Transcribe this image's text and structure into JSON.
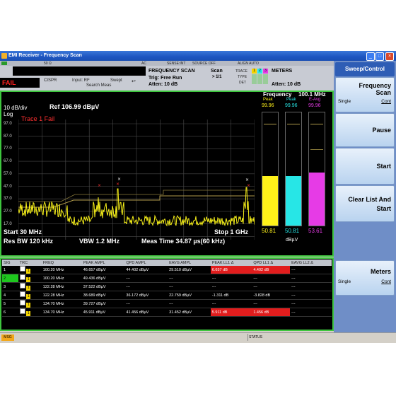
{
  "window": {
    "title": "EMI Receiver  - Frequency Scan",
    "controls": [
      "_",
      "□",
      "×"
    ]
  },
  "header": {
    "row1": {
      "impedance": "50 Ω",
      "coupling": "AC",
      "sense": "SENSE:INT",
      "source": "SOURCE OFF",
      "align": "ALIGN AUTO"
    },
    "cispr": "CISPR",
    "input": "Input: RF",
    "swept": "Swept",
    "search": "Search Meas",
    "scan_mode": "FREQUENCY SCAN",
    "trig": "Trig: Free Run",
    "atten_left": "Atten: 10 dB",
    "scan_label": "Scan",
    "scan_count": "> 1/1",
    "trace_label": "TRACE",
    "type_label": "TYPE",
    "det_label": "DET",
    "trace_nums": [
      "1",
      "2",
      "3"
    ],
    "meters_label": "METERS",
    "atten_right": "Atten: 10 dB",
    "fail": "FAIL"
  },
  "plot": {
    "scale": "10 dB/div",
    "log": "Log",
    "ref": "Ref 106.99 dBµV",
    "trace_fail": "Trace 1 Fail",
    "y_ticks": [
      "97.0",
      "87.0",
      "77.0",
      "67.0",
      "57.0",
      "47.0",
      "37.0",
      "27.0",
      "17.0"
    ],
    "start": "Start 30 MHz",
    "stop": "Stop 1 GHz",
    "res_bw": "Res BW 120 kHz",
    "vbw": "VBW 1.2 MHz",
    "meas_time": "Meas Time 34.87 µs(60 kHz)",
    "colors": {
      "trace": "#f5ee19",
      "limit": "#b09a4a",
      "grid": "#4b4b4b",
      "frame": "#3ec63e"
    }
  },
  "meters": {
    "title": "Frequency",
    "freq": "100.1 MHz",
    "headers": [
      "Peak",
      "Peak",
      "E-Avg"
    ],
    "values_top": [
      "99.96",
      "99.96",
      "99.96"
    ],
    "readings": [
      "50.81",
      "50.81",
      "53.61"
    ],
    "unit": "dBµV",
    "level_fraction": [
      0.44,
      0.44,
      0.47
    ],
    "colors": [
      "#fff21a",
      "#27e6e6",
      "#e63be6"
    ]
  },
  "table": {
    "headers": [
      "SIG",
      "TRC",
      "FREQ",
      "PEAK AMPL",
      "QPD AMPL",
      "EAVG AMPL",
      "PEAK LL1 Δ",
      "QPD LL1 Δ",
      "EAVG LL2 Δ"
    ],
    "rows": [
      {
        "sig": "1",
        "trc": "1",
        "freq": "100.20 MHz",
        "peak": "46.657 dBµV",
        "qpd": "44.402 dBµV",
        "eavg": "29.510 dBµV",
        "pk_d": "6.657 dB",
        "qpd_d": "4.402 dB",
        "eavg_d": "---"
      },
      {
        "sig": "2",
        "trc": "1",
        "freq": "100.20 MHz",
        "peak": "49.436 dBµV",
        "qpd": "---",
        "eavg": "---",
        "pk_d": "---",
        "qpd_d": "---",
        "eavg_d": "---"
      },
      {
        "sig": "3",
        "trc": "1",
        "freq": "122.28 MHz",
        "peak": "37.522 dBµV",
        "qpd": "---",
        "eavg": "---",
        "pk_d": "---",
        "qpd_d": "---",
        "eavg_d": "---"
      },
      {
        "sig": "4",
        "trc": "1",
        "freq": "122.28 MHz",
        "peak": "38.689 dBµV",
        "qpd": "36.172 dBµV",
        "eavg": "22.759 dBµV",
        "pk_d": "-1.311 dB",
        "qpd_d": "-3.828 dB",
        "eavg_d": "---"
      },
      {
        "sig": "5",
        "trc": "1",
        "freq": "134.70 MHz",
        "peak": "39.727 dBµV",
        "qpd": "---",
        "eavg": "---",
        "pk_d": "---",
        "qpd_d": "---",
        "eavg_d": "---"
      },
      {
        "sig": "6",
        "trc": "1",
        "freq": "134.70 MHz",
        "peak": "45.911 dBµV",
        "qpd": "41.456 dBµV",
        "eavg": "31.452 dBµV",
        "pk_d": "5.911 dB",
        "qpd_d": "1.456 dB",
        "eavg_d": "---"
      }
    ]
  },
  "softkeys": {
    "title": "Sweep/Control",
    "frequency_scan": {
      "label1": "Frequency",
      "label2": "Scan",
      "left": "Single",
      "right": "Cont"
    },
    "pause": "Pause",
    "start": "Start",
    "clear_list": {
      "label1": "Clear List And",
      "label2": "Start"
    },
    "meters": {
      "label": "Meters",
      "left": "Single",
      "right": "Cont"
    }
  },
  "status": {
    "msg": "MSG",
    "status": "STATUS"
  }
}
